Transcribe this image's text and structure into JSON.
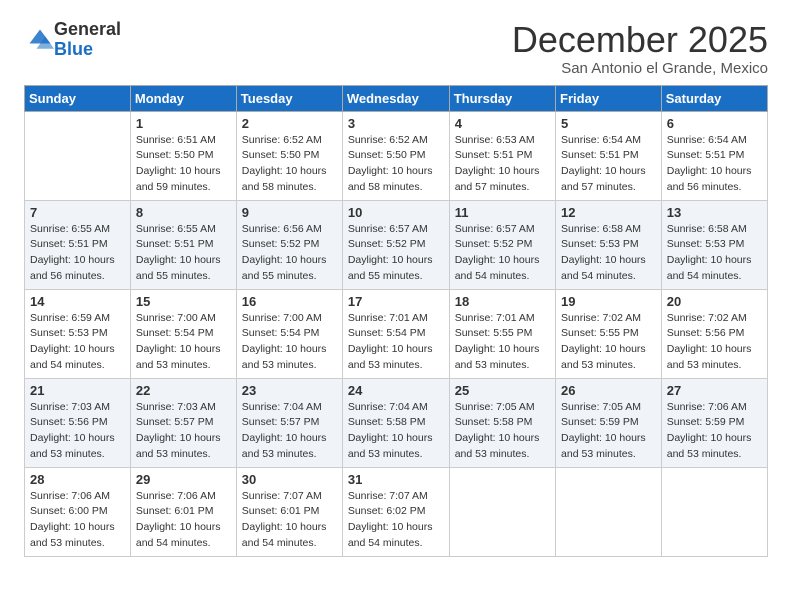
{
  "logo": {
    "general": "General",
    "blue": "Blue"
  },
  "title": "December 2025",
  "subtitle": "San Antonio el Grande, Mexico",
  "days": [
    "Sunday",
    "Monday",
    "Tuesday",
    "Wednesday",
    "Thursday",
    "Friday",
    "Saturday"
  ],
  "weeks": [
    [
      {
        "date": "",
        "info": ""
      },
      {
        "date": "1",
        "info": "Sunrise: 6:51 AM\nSunset: 5:50 PM\nDaylight: 10 hours\nand 59 minutes."
      },
      {
        "date": "2",
        "info": "Sunrise: 6:52 AM\nSunset: 5:50 PM\nDaylight: 10 hours\nand 58 minutes."
      },
      {
        "date": "3",
        "info": "Sunrise: 6:52 AM\nSunset: 5:50 PM\nDaylight: 10 hours\nand 58 minutes."
      },
      {
        "date": "4",
        "info": "Sunrise: 6:53 AM\nSunset: 5:51 PM\nDaylight: 10 hours\nand 57 minutes."
      },
      {
        "date": "5",
        "info": "Sunrise: 6:54 AM\nSunset: 5:51 PM\nDaylight: 10 hours\nand 57 minutes."
      },
      {
        "date": "6",
        "info": "Sunrise: 6:54 AM\nSunset: 5:51 PM\nDaylight: 10 hours\nand 56 minutes."
      }
    ],
    [
      {
        "date": "7",
        "info": "Sunrise: 6:55 AM\nSunset: 5:51 PM\nDaylight: 10 hours\nand 56 minutes."
      },
      {
        "date": "8",
        "info": "Sunrise: 6:55 AM\nSunset: 5:51 PM\nDaylight: 10 hours\nand 55 minutes."
      },
      {
        "date": "9",
        "info": "Sunrise: 6:56 AM\nSunset: 5:52 PM\nDaylight: 10 hours\nand 55 minutes."
      },
      {
        "date": "10",
        "info": "Sunrise: 6:57 AM\nSunset: 5:52 PM\nDaylight: 10 hours\nand 55 minutes."
      },
      {
        "date": "11",
        "info": "Sunrise: 6:57 AM\nSunset: 5:52 PM\nDaylight: 10 hours\nand 54 minutes."
      },
      {
        "date": "12",
        "info": "Sunrise: 6:58 AM\nSunset: 5:53 PM\nDaylight: 10 hours\nand 54 minutes."
      },
      {
        "date": "13",
        "info": "Sunrise: 6:58 AM\nSunset: 5:53 PM\nDaylight: 10 hours\nand 54 minutes."
      }
    ],
    [
      {
        "date": "14",
        "info": "Sunrise: 6:59 AM\nSunset: 5:53 PM\nDaylight: 10 hours\nand 54 minutes."
      },
      {
        "date": "15",
        "info": "Sunrise: 7:00 AM\nSunset: 5:54 PM\nDaylight: 10 hours\nand 53 minutes."
      },
      {
        "date": "16",
        "info": "Sunrise: 7:00 AM\nSunset: 5:54 PM\nDaylight: 10 hours\nand 53 minutes."
      },
      {
        "date": "17",
        "info": "Sunrise: 7:01 AM\nSunset: 5:54 PM\nDaylight: 10 hours\nand 53 minutes."
      },
      {
        "date": "18",
        "info": "Sunrise: 7:01 AM\nSunset: 5:55 PM\nDaylight: 10 hours\nand 53 minutes."
      },
      {
        "date": "19",
        "info": "Sunrise: 7:02 AM\nSunset: 5:55 PM\nDaylight: 10 hours\nand 53 minutes."
      },
      {
        "date": "20",
        "info": "Sunrise: 7:02 AM\nSunset: 5:56 PM\nDaylight: 10 hours\nand 53 minutes."
      }
    ],
    [
      {
        "date": "21",
        "info": "Sunrise: 7:03 AM\nSunset: 5:56 PM\nDaylight: 10 hours\nand 53 minutes."
      },
      {
        "date": "22",
        "info": "Sunrise: 7:03 AM\nSunset: 5:57 PM\nDaylight: 10 hours\nand 53 minutes."
      },
      {
        "date": "23",
        "info": "Sunrise: 7:04 AM\nSunset: 5:57 PM\nDaylight: 10 hours\nand 53 minutes."
      },
      {
        "date": "24",
        "info": "Sunrise: 7:04 AM\nSunset: 5:58 PM\nDaylight: 10 hours\nand 53 minutes."
      },
      {
        "date": "25",
        "info": "Sunrise: 7:05 AM\nSunset: 5:58 PM\nDaylight: 10 hours\nand 53 minutes."
      },
      {
        "date": "26",
        "info": "Sunrise: 7:05 AM\nSunset: 5:59 PM\nDaylight: 10 hours\nand 53 minutes."
      },
      {
        "date": "27",
        "info": "Sunrise: 7:06 AM\nSunset: 5:59 PM\nDaylight: 10 hours\nand 53 minutes."
      }
    ],
    [
      {
        "date": "28",
        "info": "Sunrise: 7:06 AM\nSunset: 6:00 PM\nDaylight: 10 hours\nand 53 minutes."
      },
      {
        "date": "29",
        "info": "Sunrise: 7:06 AM\nSunset: 6:01 PM\nDaylight: 10 hours\nand 54 minutes."
      },
      {
        "date": "30",
        "info": "Sunrise: 7:07 AM\nSunset: 6:01 PM\nDaylight: 10 hours\nand 54 minutes."
      },
      {
        "date": "31",
        "info": "Sunrise: 7:07 AM\nSunset: 6:02 PM\nDaylight: 10 hours\nand 54 minutes."
      },
      {
        "date": "",
        "info": ""
      },
      {
        "date": "",
        "info": ""
      },
      {
        "date": "",
        "info": ""
      }
    ]
  ]
}
